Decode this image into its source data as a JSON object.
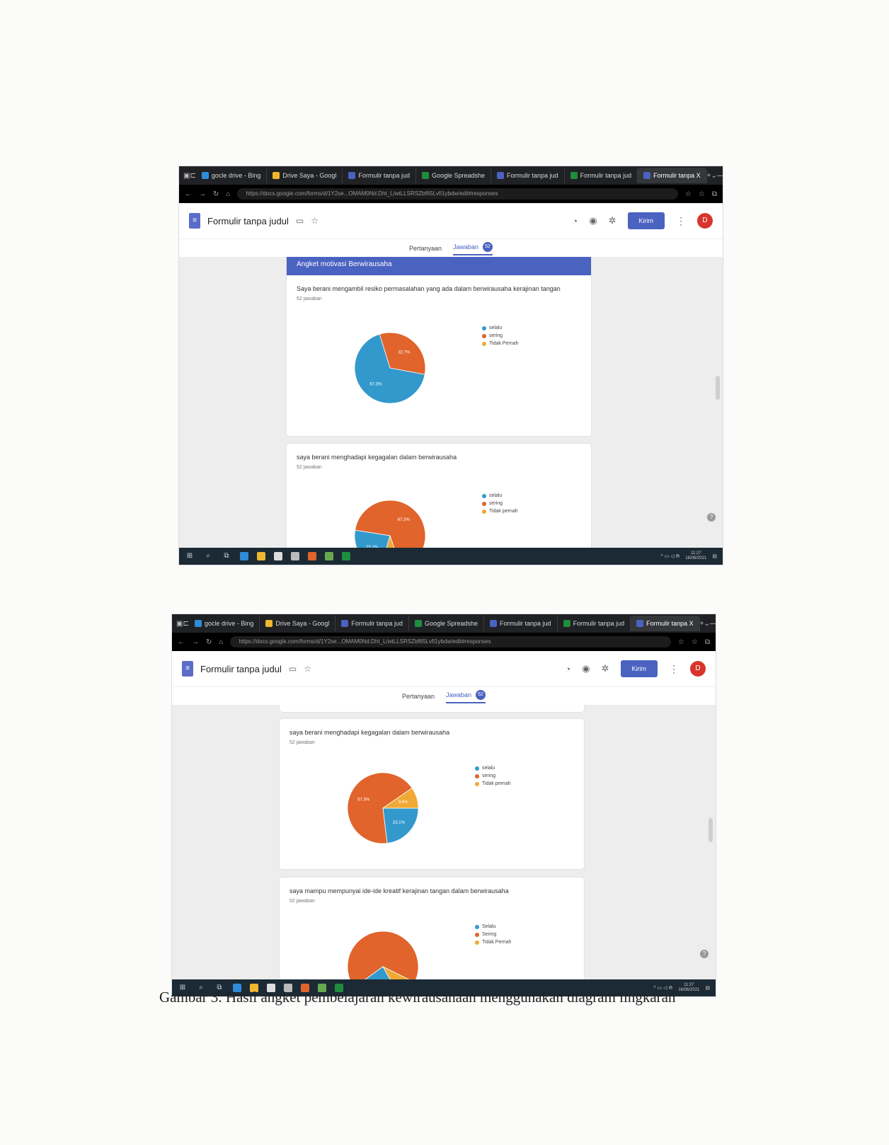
{
  "browser": {
    "tabs": [
      "gocle drive - Bing",
      "Drive Saya - Googl",
      "Formulir tanpa jud",
      "Google Spreadshe",
      "Formulir tanpa jud",
      "Formulir tanpa jud",
      "Formulir tanpa X"
    ],
    "tab_colors": [
      "#2f8cd8",
      "#f0b72f",
      "#4a62c0",
      "#1e8e3e",
      "#4a62c0",
      "#1e8e3e",
      "#4a62c0"
    ],
    "url": "https://docs.google.com/forms/d/1Y2se...OMAM0Nd.Dht_L/wtLLSRSZbf65Lvfi1ybdw/edit#responses"
  },
  "form": {
    "title": "Formulir tanpa judul",
    "send_label": "Kirim",
    "avatar_letter": "D",
    "tab_questions": "Pertanyaan",
    "tab_answers": "Jawaban",
    "answer_count": "52",
    "survey_title": "Angket motivasi Berwirausaha"
  },
  "screenshot1": {
    "q1": {
      "question": "Saya berani mengambil resiko permasalahan yang ada dalam berwirausaha kerajinan tangan",
      "responses": "52 jawaban",
      "legend": [
        "selalu",
        "sering",
        "Tidak Pernah"
      ]
    },
    "q2": {
      "question": "saya berani menghadapi kegagalan dalam berwirausaha",
      "responses": "52 jawaban",
      "legend": [
        "selalu",
        "sering",
        "Tidak pernah"
      ]
    }
  },
  "screenshot2": {
    "q2": {
      "question": "saya berani menghadapi kegagalan dalam berwirausaha",
      "responses": "52 jawaban",
      "legend": [
        "selalu",
        "sering",
        "Tidak pernah"
      ]
    },
    "q3": {
      "question": "saya mampu mempunyai ide-ide kreatif kerajinan tangan dalam berwirausaha",
      "responses": "52 jawaban",
      "legend": [
        "Selalu",
        "Sering",
        "Tidak Pernah"
      ]
    }
  },
  "taskbar": {
    "time": "11:27",
    "date": "16/06/2021"
  },
  "colors": {
    "blue": "#3399cc",
    "orange": "#e0642b",
    "yellow": "#f0a934",
    "accent": "#4a62c0"
  },
  "caption": "Gambar 3.  Hasil angket pembelajaran kewirausahaan menggunakan diagram lingkaran",
  "chart_data": [
    {
      "type": "pie",
      "title": "Saya berani mengambil resiko permasalahan yang ada dalam berwirausaha kerajinan tangan",
      "categories": [
        "selalu",
        "sering",
        "Tidak Pernah"
      ],
      "values": [
        67.3,
        32.7,
        0
      ],
      "value_labels": [
        "67.3%",
        "32.7%",
        ""
      ],
      "colors": [
        "#3399cc",
        "#e0642b",
        "#f0a934"
      ],
      "legend": "right"
    },
    {
      "type": "pie",
      "title": "saya berani menghadapi kegagalan dalam berwirausaha",
      "categories": [
        "selalu",
        "sering",
        "Tidak pernah"
      ],
      "values": [
        23.1,
        67.3,
        9.6
      ],
      "value_labels": [
        "23.1%",
        "67.3%",
        "9.6%"
      ],
      "colors": [
        "#3399cc",
        "#e0642b",
        "#f0a934"
      ],
      "legend": "right"
    }
  ]
}
